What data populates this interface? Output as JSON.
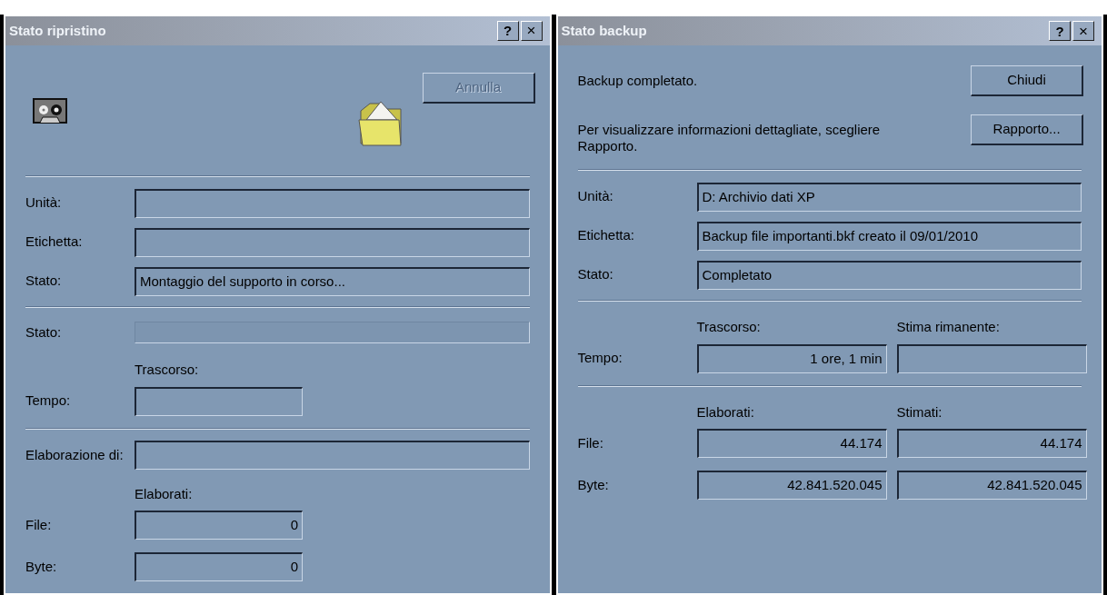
{
  "windows": [
    {
      "title": "Stato ripristino",
      "help_button": "?",
      "close_button": "×",
      "header": {
        "kind": "icons",
        "button": {
          "label": "Annulla",
          "disabled": true
        }
      },
      "sections": [
        {
          "items": [
            {
              "kind": "field",
              "label": "Unità:"
            },
            {
              "kind": "field",
              "label": "Etichetta:"
            },
            {
              "kind": "field",
              "label": "Stato:",
              "value": "Montaggio del supporto in corso..."
            }
          ]
        },
        {
          "items": [
            {
              "kind": "progress",
              "label": "Stato:",
              "level": 0
            },
            {
              "kind": "grid",
              "columns": [
                "Trascorso:"
              ],
              "rows": [
                {
                  "label": "Tempo:",
                  "cells": [
                    {}
                  ]
                }
              ]
            }
          ]
        },
        {
          "items": [
            {
              "kind": "field",
              "label": "Elaborazione di:"
            },
            {
              "kind": "grid",
              "columns": [
                "Elaborati:"
              ],
              "rows": [
                {
                  "label": "File:",
                  "cells": [
                    {
                      "value": "0"
                    }
                  ]
                },
                {
                  "label": "Byte:",
                  "cells": [
                    {
                      "value": "0"
                    }
                  ]
                }
              ]
            }
          ]
        }
      ]
    },
    {
      "title": "Stato backup",
      "help_button": "?",
      "close_button": "×",
      "header": {
        "kind": "messages",
        "rows": [
          {
            "text": "Backup completato.",
            "button": {
              "label": "Chiudi",
              "disabled": false
            }
          },
          {
            "text": "Per visualizzare informazioni dettagliate, scegliere Rapporto.",
            "button": {
              "label": "Rapporto...",
              "disabled": false
            }
          }
        ]
      },
      "sections": [
        {
          "items": [
            {
              "kind": "field",
              "label": "Unità:",
              "value": "D: Archivio dati XP"
            },
            {
              "kind": "field",
              "label": "Etichetta:",
              "value": "Backup file importanti.bkf creato il 09/01/2010"
            },
            {
              "kind": "field",
              "label": "Stato:",
              "value": "Completato"
            }
          ]
        },
        {
          "items": [
            {
              "kind": "grid",
              "columns": [
                "Trascorso:",
                "Stima rimanente:"
              ],
              "rows": [
                {
                  "label": "Tempo:",
                  "cells": [
                    {
                      "value": "1 ore, 1 min"
                    },
                    {}
                  ]
                }
              ]
            }
          ]
        },
        {
          "items": [
            {
              "kind": "grid",
              "columns": [
                "Elaborati:",
                "Stimati:"
              ],
              "rows": [
                {
                  "label": "File:",
                  "cells": [
                    {
                      "value": "44.174"
                    },
                    {
                      "value": "44.174"
                    }
                  ]
                },
                {
                  "label": "Byte:",
                  "cells": [
                    {
                      "value": "42.841.520.045"
                    },
                    {
                      "value": "42.841.520.045"
                    }
                  ]
                }
              ]
            }
          ]
        }
      ]
    }
  ]
}
